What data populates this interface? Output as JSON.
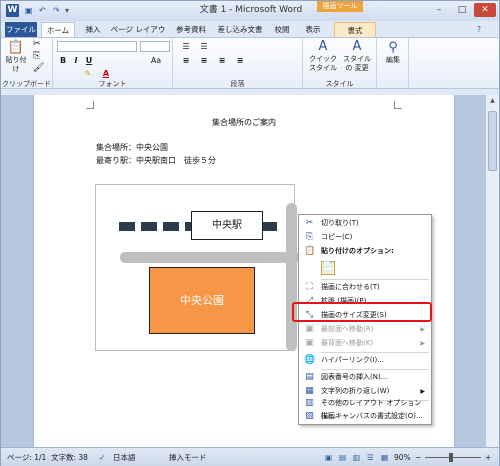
{
  "window": {
    "title": "文書 1 - Microsoft Word",
    "context_tools_label": "描画ツール",
    "app_icon": "W",
    "qat": {
      "save_icon": "save-icon",
      "undo_icon": "undo-icon",
      "redo_icon": "redo-icon"
    },
    "controls": {
      "minimize": "–",
      "maximize": "□",
      "close": "✕"
    }
  },
  "tabs": {
    "file": "ファイル",
    "home": "ホーム",
    "insert": "挿入",
    "page_layout": "ページ レイアウト",
    "references": "参考資料",
    "mailings": "差し込み文書",
    "review": "校閲",
    "view": "表示",
    "format": "書式"
  },
  "ribbon": {
    "clipboard": {
      "label": "クリップボード",
      "paste": "貼り付け"
    },
    "font": {
      "label": "フォント",
      "bold": "B",
      "italic": "I",
      "underline": "U",
      "color_a": "A",
      "aa": "Aa"
    },
    "paragraph": {
      "label": "段落"
    },
    "styles": {
      "label": "スタイル",
      "quick": "クイック スタイル",
      "change": "スタイルの 変更"
    },
    "editing": {
      "label": "編集"
    }
  },
  "document": {
    "heading": "集合場所のご案内",
    "line1": "集合場所：中央公園",
    "line2": "最寄り駅：中央駅南口　徒歩５分",
    "station_label": "中央駅",
    "park_label": "中央公園"
  },
  "context_menu": {
    "items": [
      {
        "label": "切り取り(T)",
        "icon": "scissors-icon",
        "disabled": false
      },
      {
        "label": "コピー(C)",
        "icon": "copy-icon",
        "disabled": false
      },
      {
        "label": "貼り付けのオプション:",
        "icon": "paste-icon",
        "disabled": false
      },
      {
        "label": "描画に合わせる(T)",
        "icon": "fit-icon",
        "disabled": false
      },
      {
        "label": "拡張 (描画)(P)",
        "icon": "expand-icon",
        "disabled": false
      },
      {
        "label": "描画のサイズ変更(S)",
        "icon": "resize-icon",
        "disabled": false
      },
      {
        "label": "最前面へ移動(R)",
        "icon": "bring-front-icon",
        "disabled": true
      },
      {
        "label": "最背面へ移動(K)",
        "icon": "send-back-icon",
        "disabled": true
      },
      {
        "label": "ハイパーリンク(I)...",
        "icon": "hyperlink-icon",
        "disabled": false
      },
      {
        "label": "図表番号の挿入(N)...",
        "icon": "caption-icon",
        "disabled": false
      },
      {
        "label": "文字列の折り返し(W)",
        "icon": "wrap-icon",
        "disabled": false
      },
      {
        "label": "その他のレイアウト オプション(L)...",
        "icon": "layout-icon",
        "disabled": false
      },
      {
        "label": "描画キャンバスの書式設定(O)...",
        "icon": "format-canvas-icon",
        "disabled": false
      }
    ]
  },
  "statusbar": {
    "page": "ページ: 1/1",
    "words": "文字数: 38",
    "language": "日本語",
    "mode": "挿入モード",
    "zoom": "90%"
  },
  "colors": {
    "accent": "#2b579a",
    "park": "#f79646",
    "highlight": "#e5141b",
    "road": "#bfbfbf"
  }
}
